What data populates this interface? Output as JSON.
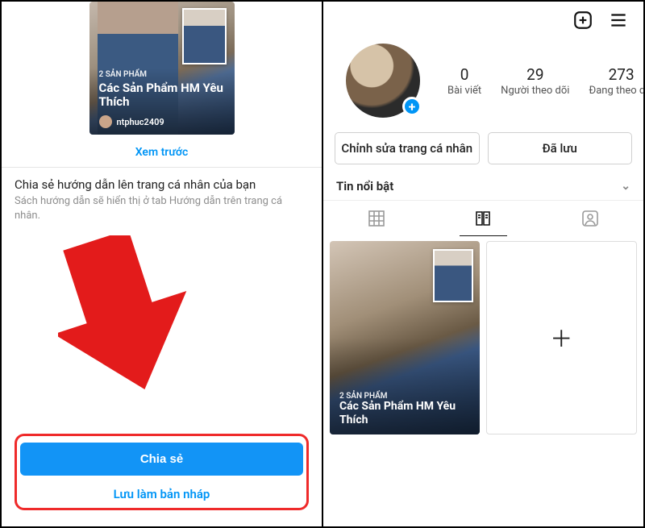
{
  "left": {
    "guide_card": {
      "subtitle": "2 SẢN PHẨM",
      "title": "Các Sản Phẩm HM Yêu Thích",
      "author": "ntphuc2409"
    },
    "preview_link": "Xem trước",
    "share_heading": "Chia sẻ hướng dẫn lên trang cá nhân của bạn",
    "share_body": "Sách hướng dẫn sẽ hiển thị ở tab Hướng dẫn trên trang cá nhân.",
    "primary_button": "Chia sẻ",
    "secondary_button": "Lưu làm bản nháp"
  },
  "right": {
    "stats": {
      "posts": {
        "num": "0",
        "label": "Bài viết"
      },
      "followers": {
        "num": "29",
        "label": "Người theo dõi"
      },
      "following": {
        "num": "273",
        "label": "Đang theo dõi"
      }
    },
    "edit_profile_btn": "Chỉnh sửa trang cá nhân",
    "saved_btn": "Đã lưu",
    "highlights_label": "Tin nổi bật",
    "guide_tile": {
      "subtitle": "2 SẢN PHẨM",
      "title": "Các Sản Phẩm HM Yêu Thích"
    }
  },
  "icons": {
    "create": "create-icon",
    "menu": "menu-icon",
    "grid": "grid-icon",
    "guide": "guide-icon",
    "tagged": "tagged-icon",
    "chevron": "chevron-down-icon",
    "add": "plus-icon"
  }
}
